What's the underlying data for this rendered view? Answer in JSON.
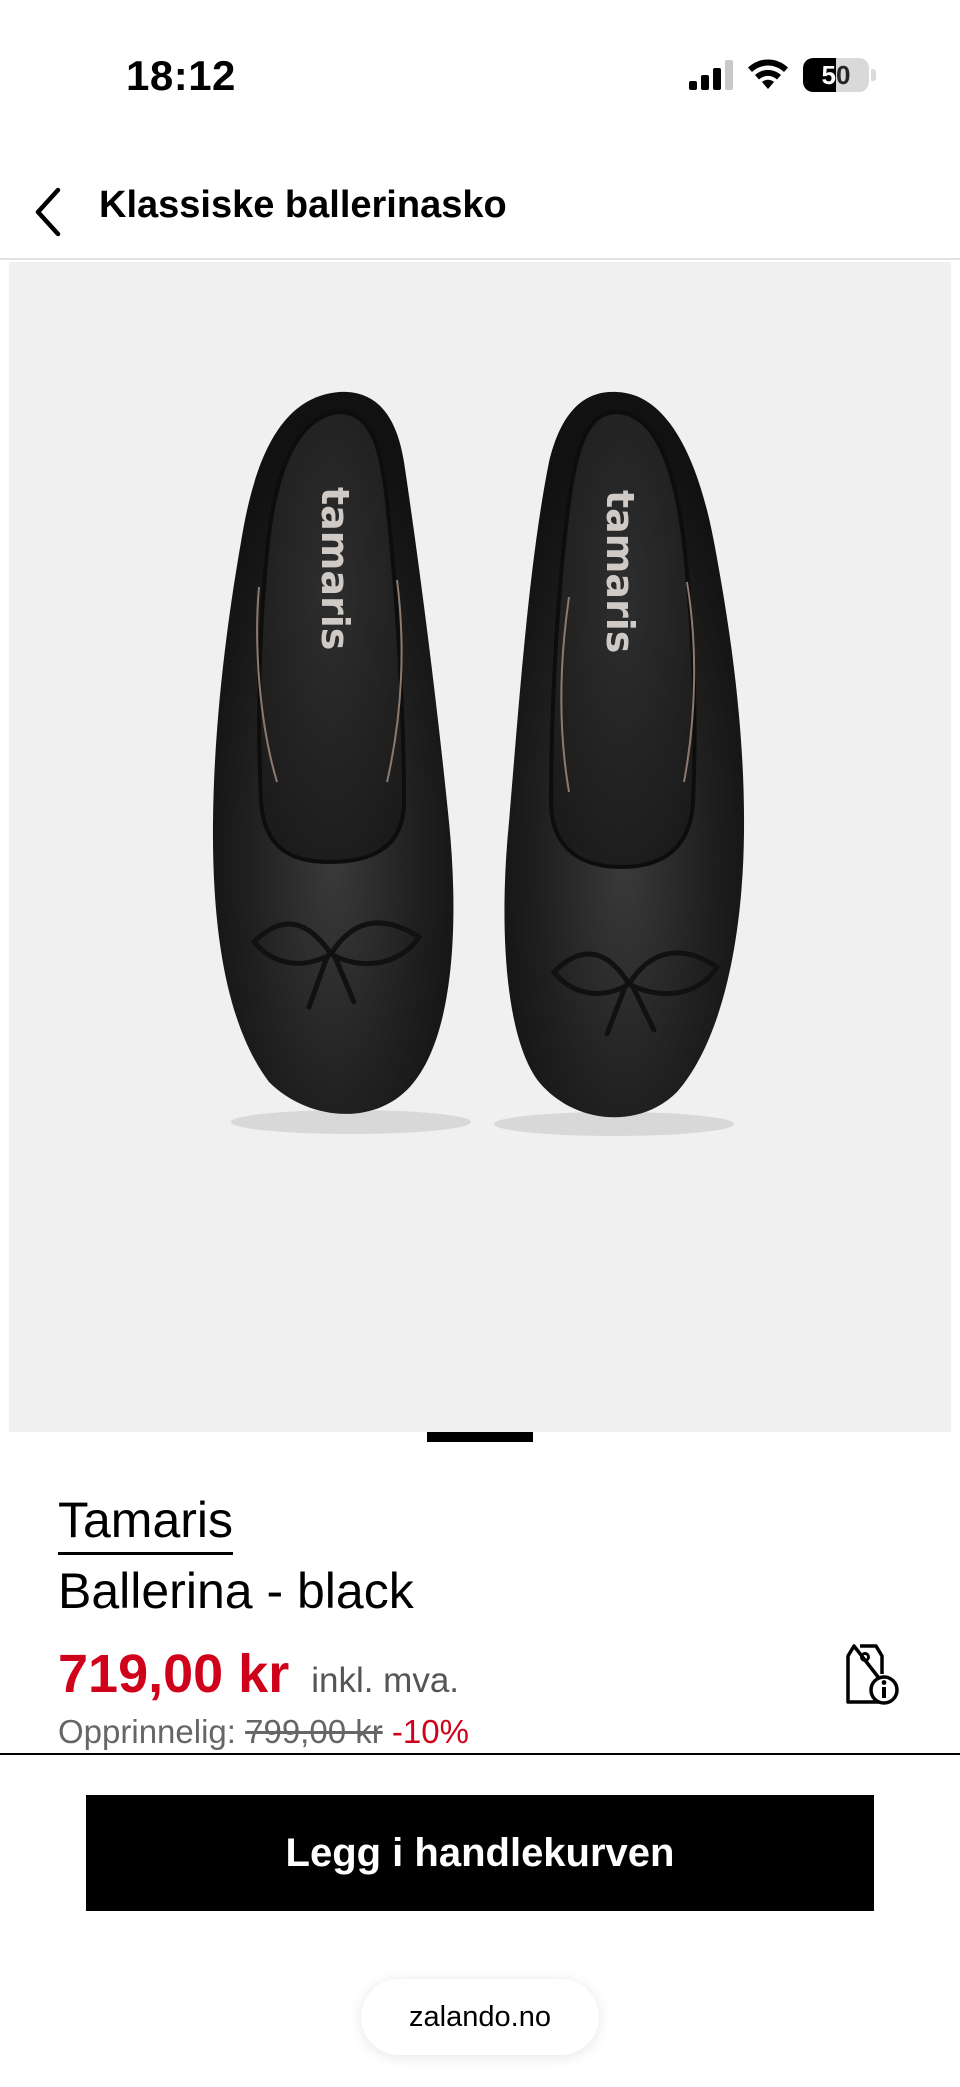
{
  "status_bar": {
    "time": "18:12",
    "battery_level": "50",
    "icons": [
      "cellular-signal-icon",
      "wifi-icon",
      "battery-icon"
    ]
  },
  "header": {
    "title": "Klassiske ballerinasko",
    "back_icon": "chevron-left-icon"
  },
  "product": {
    "image_alt": "Tamaris black leather ballerina flats with bow, top view",
    "insole_text": "tamaris",
    "brand": "Tamaris",
    "name": "Ballerina - black",
    "price": "719,00 kr",
    "price_note": "inkl. mva.",
    "original_label": "Opprinnelig:",
    "original_price": "799,00 kr",
    "discount": "-10%",
    "price_info_icon": "price-tag-info-icon"
  },
  "carousel": {
    "active_index": 1
  },
  "actions": {
    "add_to_cart_label": "Legg i handlekurven"
  },
  "browser": {
    "url": "zalando.no"
  },
  "colors": {
    "price_red": "#d0021b",
    "image_bg": "#f0f0f0",
    "button_bg": "#000000"
  }
}
